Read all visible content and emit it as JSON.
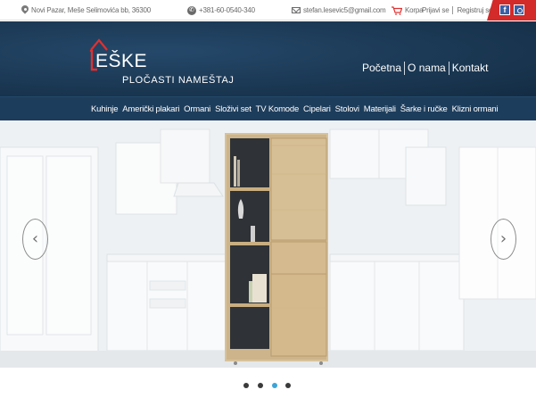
{
  "topbar": {
    "address": "Novi Pazar, Meše Selimovića bb, 36300",
    "phone": "+381-60-0540-340",
    "email": "stefan.lesevic5@gmail.com",
    "cart_label": "Korpa",
    "login_label": "Prijavi se",
    "register_label": "Registruj se",
    "social": {
      "facebook_glyph": "f",
      "accent_color": "#d32a2a",
      "facebook_color": "#3b5fa5"
    }
  },
  "header": {
    "brand": "EŠKE",
    "subtitle": "PLOČASTI NAMEŠTAJ",
    "nav": [
      "Početna",
      "O nama",
      "Kontakt"
    ]
  },
  "categories": [
    "Kuhinje",
    "Američki plakari",
    "Ormani",
    "Složivi set",
    "TV Komode",
    "Cipelari",
    "Stolovi",
    "Materijali",
    "Šarke i ručke",
    "Klizni ormani"
  ],
  "slider": {
    "prev_glyph": "‹",
    "next_glyph": "›",
    "slide_count": 4,
    "active_index": 2
  },
  "colors": {
    "header_bg": "#1c3a56",
    "nav_bg": "#1d3d5c",
    "active_dot": "#3aa5d8",
    "logo_red": "#e03030"
  }
}
